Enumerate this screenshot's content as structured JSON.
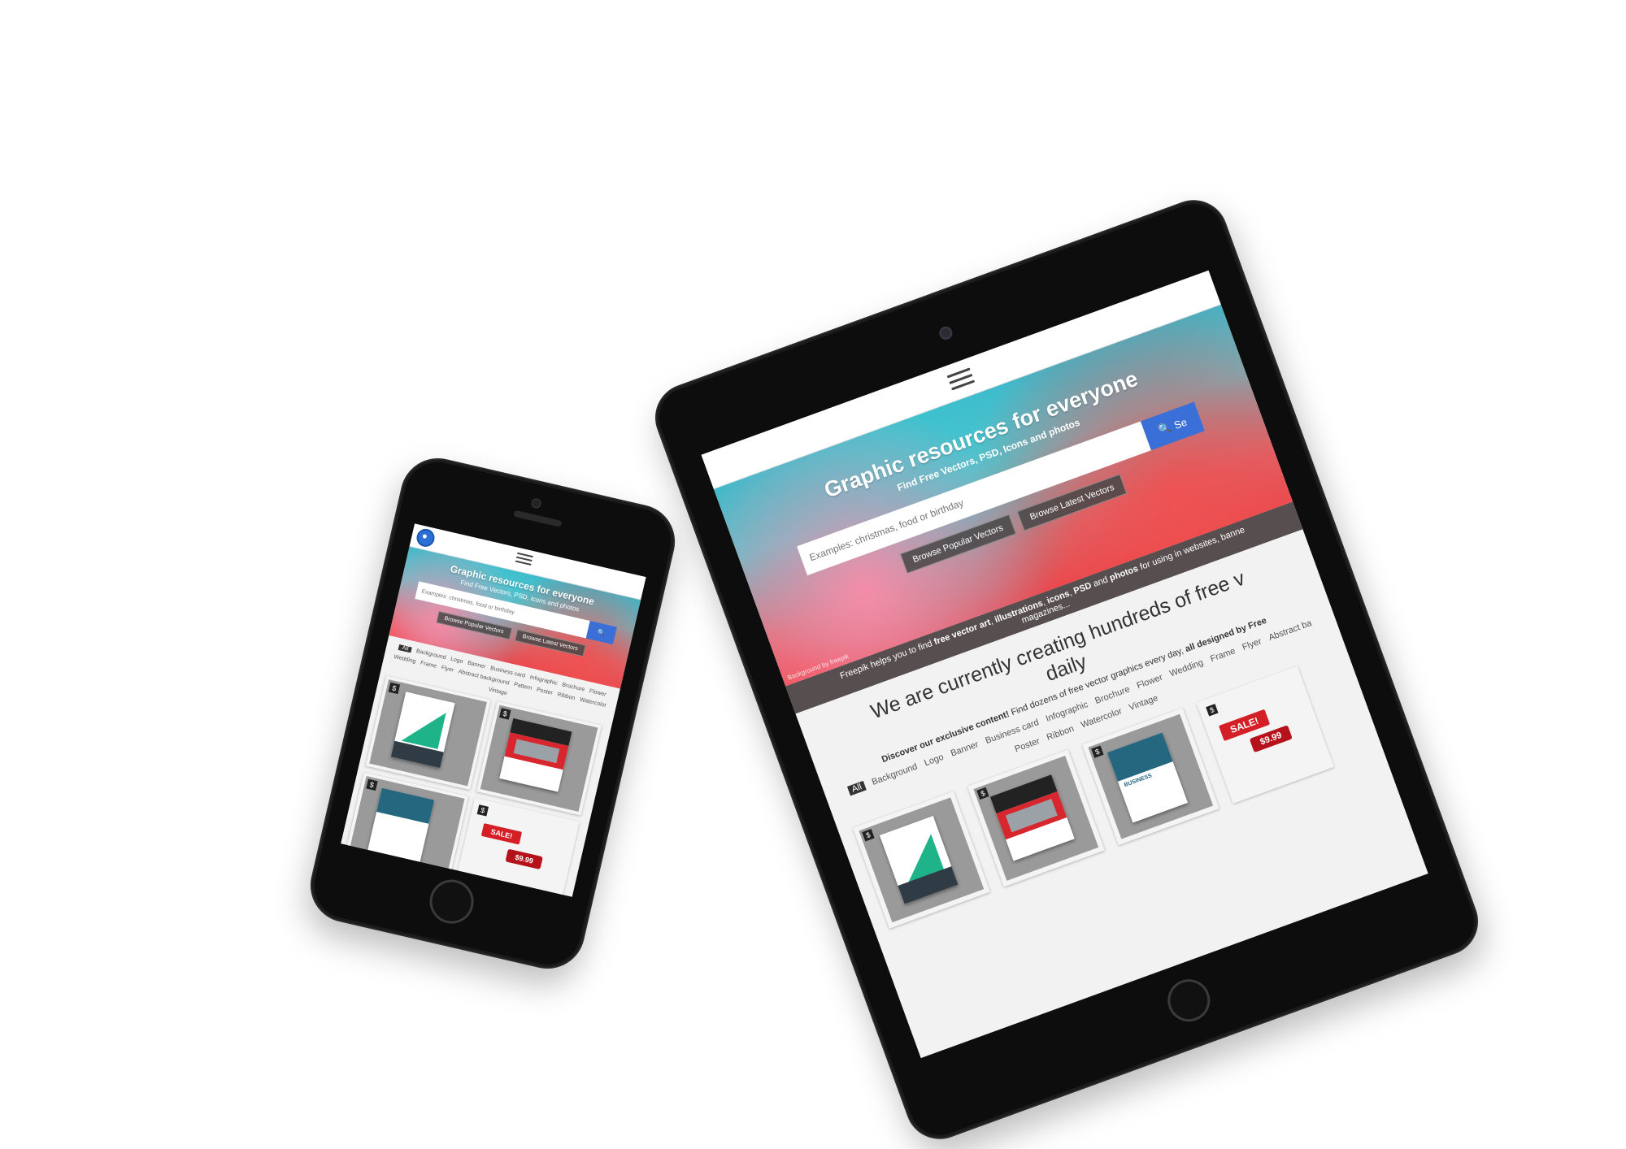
{
  "hero": {
    "title": "Graphic resources for everyone",
    "subtitle": "Find Free Vectors, PSD, Icons and photos",
    "search_placeholder": "Examples: christmas, food or birthday",
    "search_button": "Se",
    "browse_popular": "Browse Popular Vectors",
    "browse_latest": "Browse Latest Vectors",
    "credit": "Background by freepik"
  },
  "intro": {
    "prefix": "Freepik helps you to find ",
    "b1": "free vector art",
    "sep1": ", ",
    "b2": "illustrations",
    "sep2": ", ",
    "b3": "icons",
    "sep3": ", ",
    "b4": "PSD",
    "and": " and ",
    "b5": "photos",
    "suffix": " for using in websites, banne",
    "line2": "magazines..."
  },
  "section": {
    "title": "We are currently creating hundreds of free v",
    "title2": "daily",
    "sub_bold": "Discover our exclusive content!",
    "sub_text": " Find dozens of free vector graphics every day, ",
    "sub_bold2": "all designed by Free"
  },
  "tags": [
    "All",
    "Background",
    "Logo",
    "Banner",
    "Business card",
    "Infographic",
    "Brochure",
    "Flower",
    "Wedding",
    "Frame",
    "Flyer",
    "Abstract background",
    "Pattern",
    "Poster",
    "Ribbon",
    "Watercolor",
    "Vintage"
  ],
  "tablet_tags": [
    "All",
    "Background",
    "Logo",
    "Banner",
    "Business card",
    "Infographic",
    "Brochure",
    "Flower",
    "Wedding",
    "Frame",
    "Flyer",
    "Abstract ba",
    "Poster",
    "Ribbon",
    "Watercolor",
    "Vintage"
  ],
  "thumbs": {
    "business_label": "BUSINESS",
    "sale_label": "SALE!",
    "price_label": "$9.99"
  },
  "colors": {
    "accent": "#3a6fd8",
    "hero_top": "#3fb6c8",
    "hero_bottom": "#e8474d",
    "device": "#0d0d0d"
  }
}
